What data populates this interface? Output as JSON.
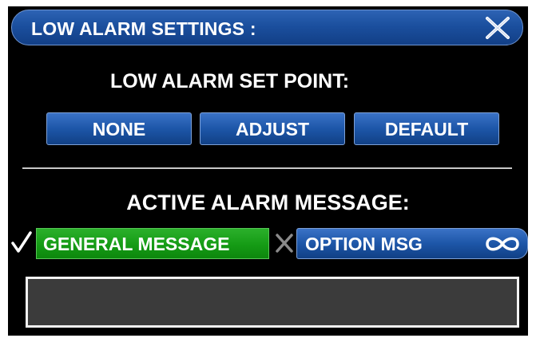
{
  "title_bar": {
    "title": "LOW ALARM SETTINGS :",
    "close_icon": "close-icon"
  },
  "set_point": {
    "heading": "LOW ALARM SET POINT:",
    "buttons": [
      {
        "label": "NONE"
      },
      {
        "label": "ADJUST"
      },
      {
        "label": "DEFAULT"
      }
    ]
  },
  "alarm_message": {
    "heading": "ACTIVE ALARM MESSAGE:",
    "general": {
      "label": "GENERAL MESSAGE",
      "state_icon": "check-icon",
      "selected": true
    },
    "option": {
      "label": "OPTION MSG",
      "state_icon": "x-icon",
      "selected": false,
      "icon": "infinity-icon"
    },
    "message_text": ""
  },
  "colors": {
    "background": "#000000",
    "button_blue": "#1d56a8",
    "active_green": "#159b15",
    "message_box": "#3b3b3b"
  }
}
